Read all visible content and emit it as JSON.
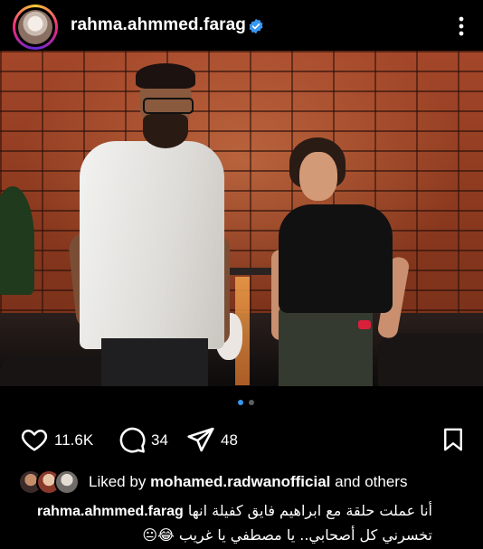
{
  "header": {
    "username": "rahma.ahmmed.farag",
    "verified_icon": "verified-badge-icon",
    "more_icon": "more-vertical-icon",
    "verified_color": "#3897f0"
  },
  "post": {
    "image_alt": "photo",
    "carousel": {
      "total": 2,
      "active": 1,
      "active_color": "#3897f0",
      "inactive_color": "#5e5e5e"
    }
  },
  "actions": {
    "likes": "11.6K",
    "comments": "34",
    "shares": "48",
    "like_icon": "heart-icon",
    "comment_icon": "comment-icon",
    "share_icon": "send-icon",
    "save_icon": "bookmark-icon"
  },
  "liked_by": {
    "prefix": "Liked by",
    "user": "mohamed.radwanofficial",
    "suffix": "and others"
  },
  "caption": {
    "username": "rahma.ahmmed.farag",
    "line1": "أنا عملت حلقة مع ابراهيم فايق كفيلة انها",
    "line2": "تخسرني كل أصحابي.. يا مصطفي يا غريب 😂😐"
  }
}
